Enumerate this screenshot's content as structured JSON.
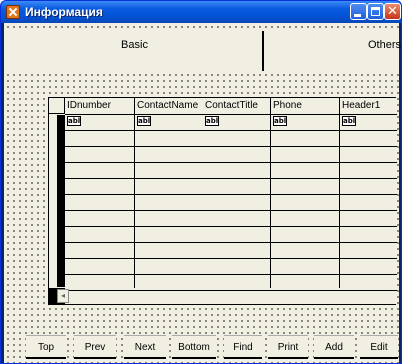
{
  "window": {
    "title": "Информация",
    "icon": "app-icon"
  },
  "tabs": [
    {
      "label": "Basic",
      "active": true
    },
    {
      "label": "Others",
      "active": false
    }
  ],
  "grid": {
    "columns": [
      "IDnumber",
      "ContactName",
      "ContactTitle",
      "Phone",
      "Header1"
    ],
    "type_icon_text": "abl",
    "visible_rows": 11
  },
  "buttons": [
    {
      "label": "Top"
    },
    {
      "label": "Prev"
    },
    {
      "label": "Next"
    },
    {
      "label": "Bottom"
    },
    {
      "label": "Find"
    },
    {
      "label": "Print"
    },
    {
      "label": "Add"
    },
    {
      "label": "Edit"
    }
  ],
  "colors": {
    "titlebar": "#0453d6",
    "client_bg": "#f1efe2"
  }
}
